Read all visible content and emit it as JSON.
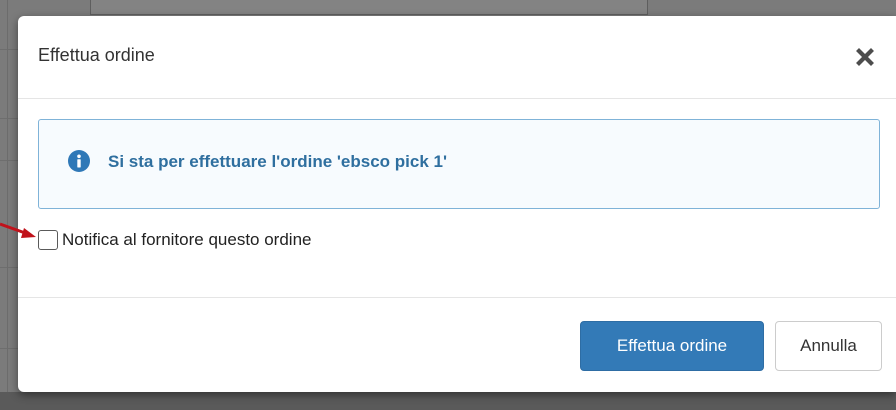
{
  "dialog": {
    "title": "Effettua ordine",
    "close_icon": "close-icon"
  },
  "alert": {
    "icon": "info-icon",
    "message": "Si sta per effettuare l'ordine 'ebsco pick 1'"
  },
  "notify_checkbox": {
    "label": "Notifica al fornitore questo ordine",
    "checked": false
  },
  "footer": {
    "confirm_label": "Effettua ordine",
    "cancel_label": "Annulla"
  },
  "colors": {
    "primary": "#337ab7",
    "info_text": "#2f6f9f",
    "info_border": "#7fb3d8",
    "annotation_arrow": "#c0121b"
  }
}
